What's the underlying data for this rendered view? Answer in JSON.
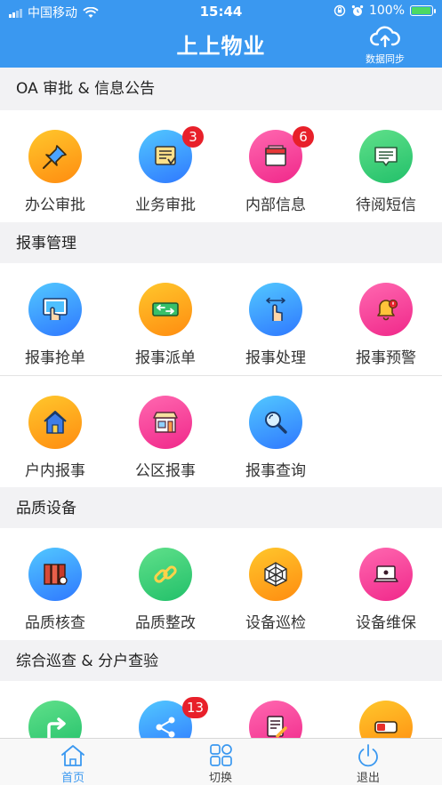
{
  "status_bar": {
    "carrier": "中国移动",
    "time": "15:44",
    "battery": "100%",
    "battery_level": 1.0
  },
  "header": {
    "title": "上上物业",
    "sync_label": "数据同步",
    "sync_icon": "cloud-sync-icon"
  },
  "sections": [
    {
      "title": "OA 审批 & 信息公告",
      "rows": [
        [
          {
            "label": "办公审批",
            "icon": "pin-icon",
            "color": "orange"
          },
          {
            "label": "业务审批",
            "icon": "approval-list-icon",
            "color": "blue",
            "badge": "3"
          },
          {
            "label": "内部信息",
            "icon": "message-box-icon",
            "color": "pink",
            "badge": "6"
          },
          {
            "label": "待阅短信",
            "icon": "sms-icon",
            "color": "green"
          }
        ]
      ]
    },
    {
      "title": "报事管理",
      "rows": [
        [
          {
            "label": "报事抢单",
            "icon": "touch-screen-icon",
            "color": "blue"
          },
          {
            "label": "报事派单",
            "icon": "dispatch-icon",
            "color": "orange"
          },
          {
            "label": "报事处理",
            "icon": "swipe-hand-icon",
            "color": "blue"
          },
          {
            "label": "报事预警",
            "icon": "bell-alert-icon",
            "color": "pink"
          }
        ],
        [
          {
            "label": "户内报事",
            "icon": "house-icon",
            "color": "orange"
          },
          {
            "label": "公区报事",
            "icon": "storefront-icon",
            "color": "pink"
          },
          {
            "label": "报事查询",
            "icon": "magnifier-icon",
            "color": "blue"
          }
        ]
      ]
    },
    {
      "title": "品质设备",
      "rows": [
        [
          {
            "label": "品质核查",
            "icon": "binders-icon",
            "color": "blue"
          },
          {
            "label": "品质整改",
            "icon": "chain-link-icon",
            "color": "green"
          },
          {
            "label": "设备巡检",
            "icon": "web-icon",
            "color": "orange"
          },
          {
            "label": "设备维保",
            "icon": "laptop-repair-icon",
            "color": "pink"
          }
        ]
      ]
    },
    {
      "title": "综合巡查 & 分户查验",
      "rows": [
        [
          {
            "label": "",
            "icon": "turn-arrow-icon",
            "color": "green"
          },
          {
            "label": "",
            "icon": "share-nodes-icon",
            "color": "blue",
            "badge": "13"
          },
          {
            "label": "",
            "icon": "document-edit-icon",
            "color": "pink"
          },
          {
            "label": "",
            "icon": "battery-card-icon",
            "color": "orange"
          }
        ]
      ]
    }
  ],
  "tabbar": {
    "home": "首页",
    "switch": "切换",
    "logout": "退出",
    "active": "home"
  }
}
